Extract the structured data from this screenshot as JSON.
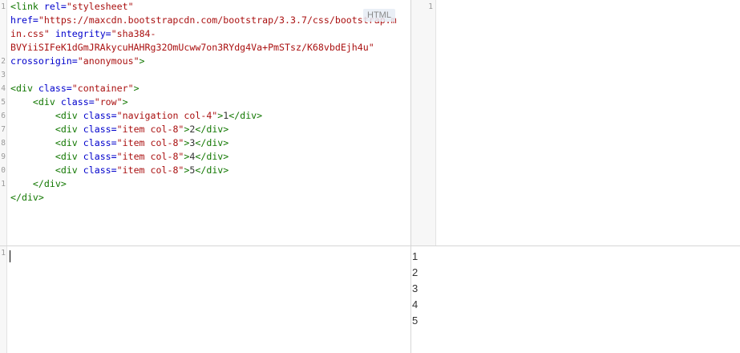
{
  "html_editor": {
    "language_badge": "HTML",
    "gutter": [
      "1",
      "",
      "",
      "",
      "2",
      "3",
      "4",
      "5",
      "6",
      "7",
      "8",
      "9",
      "0",
      "1"
    ],
    "lines": [
      [
        {
          "c": "tag",
          "t": "<link "
        },
        {
          "c": "attr",
          "t": "rel="
        },
        {
          "c": "str",
          "t": "\"stylesheet\""
        }
      ],
      [
        {
          "c": "attr",
          "t": "href="
        },
        {
          "c": "str",
          "t": "\"https://maxcdn.bootstrapcdn.com/bootstrap/3.3.7/css/bootstrap.m"
        }
      ],
      [
        {
          "c": "str",
          "t": "in.css\""
        },
        {
          "c": "txt",
          "t": " "
        },
        {
          "c": "attr",
          "t": "integrity="
        },
        {
          "c": "str",
          "t": "\"sha384-"
        }
      ],
      [
        {
          "c": "str",
          "t": "BVYiiSIFeK1dGmJRAkycuHAHRg32OmUcww7on3RYdg4Va+PmSTsz/K68vbdEjh4u\""
        }
      ],
      [
        {
          "c": "attr",
          "t": "crossorigin="
        },
        {
          "c": "str",
          "t": "\"anonymous\""
        },
        {
          "c": "tag",
          "t": ">"
        }
      ],
      [],
      [
        {
          "c": "tag",
          "t": "<div "
        },
        {
          "c": "attr",
          "t": "class="
        },
        {
          "c": "str",
          "t": "\"container\""
        },
        {
          "c": "tag",
          "t": ">"
        }
      ],
      [
        {
          "c": "txt",
          "t": "    "
        },
        {
          "c": "tag",
          "t": "<div "
        },
        {
          "c": "attr",
          "t": "class="
        },
        {
          "c": "str",
          "t": "\"row\""
        },
        {
          "c": "tag",
          "t": ">"
        }
      ],
      [
        {
          "c": "txt",
          "t": "        "
        },
        {
          "c": "tag",
          "t": "<div "
        },
        {
          "c": "attr",
          "t": "class="
        },
        {
          "c": "str",
          "t": "\"navigation col-4\""
        },
        {
          "c": "tag",
          "t": ">"
        },
        {
          "c": "txt",
          "t": "1"
        },
        {
          "c": "tag",
          "t": "</div>"
        }
      ],
      [
        {
          "c": "txt",
          "t": "        "
        },
        {
          "c": "tag",
          "t": "<div "
        },
        {
          "c": "attr",
          "t": "class="
        },
        {
          "c": "str",
          "t": "\"item col-8\""
        },
        {
          "c": "tag",
          "t": ">"
        },
        {
          "c": "txt",
          "t": "2"
        },
        {
          "c": "tag",
          "t": "</div>"
        }
      ],
      [
        {
          "c": "txt",
          "t": "        "
        },
        {
          "c": "tag",
          "t": "<div "
        },
        {
          "c": "attr",
          "t": "class="
        },
        {
          "c": "str",
          "t": "\"item col-8\""
        },
        {
          "c": "tag",
          "t": ">"
        },
        {
          "c": "txt",
          "t": "3"
        },
        {
          "c": "tag",
          "t": "</div>"
        }
      ],
      [
        {
          "c": "txt",
          "t": "        "
        },
        {
          "c": "tag",
          "t": "<div "
        },
        {
          "c": "attr",
          "t": "class="
        },
        {
          "c": "str",
          "t": "\"item col-8\""
        },
        {
          "c": "tag",
          "t": ">"
        },
        {
          "c": "txt",
          "t": "4"
        },
        {
          "c": "tag",
          "t": "</div>"
        }
      ],
      [
        {
          "c": "txt",
          "t": "        "
        },
        {
          "c": "tag",
          "t": "<div "
        },
        {
          "c": "attr",
          "t": "class="
        },
        {
          "c": "str",
          "t": "\"item col-8\""
        },
        {
          "c": "tag",
          "t": ">"
        },
        {
          "c": "txt",
          "t": "5"
        },
        {
          "c": "tag",
          "t": "</div>"
        }
      ],
      [
        {
          "c": "txt",
          "t": "    "
        },
        {
          "c": "tag",
          "t": "</div>"
        }
      ],
      [
        {
          "c": "tag",
          "t": "</div>"
        }
      ]
    ]
  },
  "css_editor": {
    "gutter": [
      "1"
    ]
  },
  "js_editor": {
    "gutter": [
      "1"
    ]
  },
  "result": {
    "items": [
      "1",
      "2",
      "3",
      "4",
      "5"
    ]
  }
}
